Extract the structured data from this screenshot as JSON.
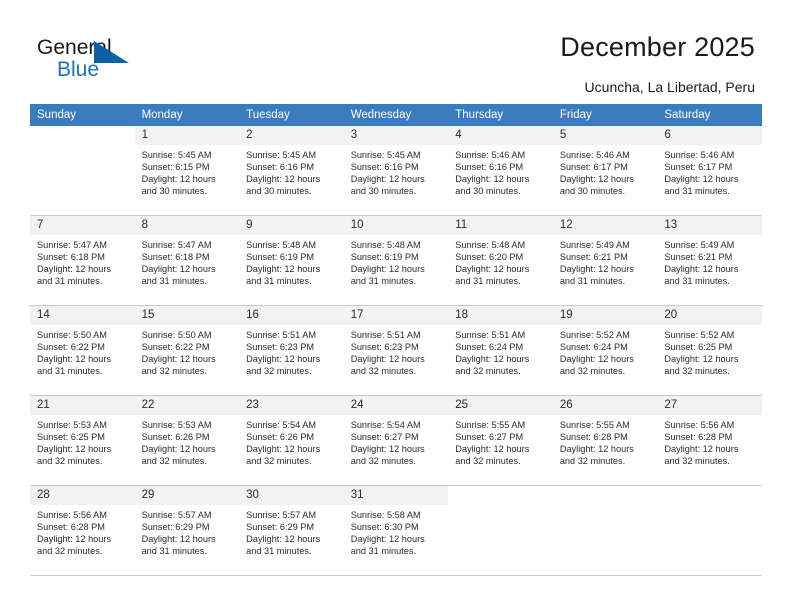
{
  "brand": {
    "name_part1": "General",
    "name_part2": "Blue"
  },
  "header": {
    "title": "December 2025",
    "location": "Ucuncha, La Libertad, Peru"
  },
  "colors": {
    "header_row_bg": "#3a7cbe",
    "daynum_bg": "#f2f2f2",
    "brand_blue": "#1d71b8",
    "text": "#2b2b2b"
  },
  "weekday_headers": [
    "Sunday",
    "Monday",
    "Tuesday",
    "Wednesday",
    "Thursday",
    "Friday",
    "Saturday"
  ],
  "labels": {
    "sunrise": "Sunrise:",
    "sunset": "Sunset:",
    "daylight": "Daylight:"
  },
  "weeks": [
    [
      {
        "day": "",
        "sunrise": "",
        "sunset": "",
        "daylight_l1": "",
        "daylight_l2": ""
      },
      {
        "day": "1",
        "sunrise": "Sunrise: 5:45 AM",
        "sunset": "Sunset: 6:15 PM",
        "daylight_l1": "Daylight: 12 hours",
        "daylight_l2": "and 30 minutes."
      },
      {
        "day": "2",
        "sunrise": "Sunrise: 5:45 AM",
        "sunset": "Sunset: 6:16 PM",
        "daylight_l1": "Daylight: 12 hours",
        "daylight_l2": "and 30 minutes."
      },
      {
        "day": "3",
        "sunrise": "Sunrise: 5:45 AM",
        "sunset": "Sunset: 6:16 PM",
        "daylight_l1": "Daylight: 12 hours",
        "daylight_l2": "and 30 minutes."
      },
      {
        "day": "4",
        "sunrise": "Sunrise: 5:46 AM",
        "sunset": "Sunset: 6:16 PM",
        "daylight_l1": "Daylight: 12 hours",
        "daylight_l2": "and 30 minutes."
      },
      {
        "day": "5",
        "sunrise": "Sunrise: 5:46 AM",
        "sunset": "Sunset: 6:17 PM",
        "daylight_l1": "Daylight: 12 hours",
        "daylight_l2": "and 30 minutes."
      },
      {
        "day": "6",
        "sunrise": "Sunrise: 5:46 AM",
        "sunset": "Sunset: 6:17 PM",
        "daylight_l1": "Daylight: 12 hours",
        "daylight_l2": "and 31 minutes."
      }
    ],
    [
      {
        "day": "7",
        "sunrise": "Sunrise: 5:47 AM",
        "sunset": "Sunset: 6:18 PM",
        "daylight_l1": "Daylight: 12 hours",
        "daylight_l2": "and 31 minutes."
      },
      {
        "day": "8",
        "sunrise": "Sunrise: 5:47 AM",
        "sunset": "Sunset: 6:18 PM",
        "daylight_l1": "Daylight: 12 hours",
        "daylight_l2": "and 31 minutes."
      },
      {
        "day": "9",
        "sunrise": "Sunrise: 5:48 AM",
        "sunset": "Sunset: 6:19 PM",
        "daylight_l1": "Daylight: 12 hours",
        "daylight_l2": "and 31 minutes."
      },
      {
        "day": "10",
        "sunrise": "Sunrise: 5:48 AM",
        "sunset": "Sunset: 6:19 PM",
        "daylight_l1": "Daylight: 12 hours",
        "daylight_l2": "and 31 minutes."
      },
      {
        "day": "11",
        "sunrise": "Sunrise: 5:48 AM",
        "sunset": "Sunset: 6:20 PM",
        "daylight_l1": "Daylight: 12 hours",
        "daylight_l2": "and 31 minutes."
      },
      {
        "day": "12",
        "sunrise": "Sunrise: 5:49 AM",
        "sunset": "Sunset: 6:21 PM",
        "daylight_l1": "Daylight: 12 hours",
        "daylight_l2": "and 31 minutes."
      },
      {
        "day": "13",
        "sunrise": "Sunrise: 5:49 AM",
        "sunset": "Sunset: 6:21 PM",
        "daylight_l1": "Daylight: 12 hours",
        "daylight_l2": "and 31 minutes."
      }
    ],
    [
      {
        "day": "14",
        "sunrise": "Sunrise: 5:50 AM",
        "sunset": "Sunset: 6:22 PM",
        "daylight_l1": "Daylight: 12 hours",
        "daylight_l2": "and 31 minutes."
      },
      {
        "day": "15",
        "sunrise": "Sunrise: 5:50 AM",
        "sunset": "Sunset: 6:22 PM",
        "daylight_l1": "Daylight: 12 hours",
        "daylight_l2": "and 32 minutes."
      },
      {
        "day": "16",
        "sunrise": "Sunrise: 5:51 AM",
        "sunset": "Sunset: 6:23 PM",
        "daylight_l1": "Daylight: 12 hours",
        "daylight_l2": "and 32 minutes."
      },
      {
        "day": "17",
        "sunrise": "Sunrise: 5:51 AM",
        "sunset": "Sunset: 6:23 PM",
        "daylight_l1": "Daylight: 12 hours",
        "daylight_l2": "and 32 minutes."
      },
      {
        "day": "18",
        "sunrise": "Sunrise: 5:51 AM",
        "sunset": "Sunset: 6:24 PM",
        "daylight_l1": "Daylight: 12 hours",
        "daylight_l2": "and 32 minutes."
      },
      {
        "day": "19",
        "sunrise": "Sunrise: 5:52 AM",
        "sunset": "Sunset: 6:24 PM",
        "daylight_l1": "Daylight: 12 hours",
        "daylight_l2": "and 32 minutes."
      },
      {
        "day": "20",
        "sunrise": "Sunrise: 5:52 AM",
        "sunset": "Sunset: 6:25 PM",
        "daylight_l1": "Daylight: 12 hours",
        "daylight_l2": "and 32 minutes."
      }
    ],
    [
      {
        "day": "21",
        "sunrise": "Sunrise: 5:53 AM",
        "sunset": "Sunset: 6:25 PM",
        "daylight_l1": "Daylight: 12 hours",
        "daylight_l2": "and 32 minutes."
      },
      {
        "day": "22",
        "sunrise": "Sunrise: 5:53 AM",
        "sunset": "Sunset: 6:26 PM",
        "daylight_l1": "Daylight: 12 hours",
        "daylight_l2": "and 32 minutes."
      },
      {
        "day": "23",
        "sunrise": "Sunrise: 5:54 AM",
        "sunset": "Sunset: 6:26 PM",
        "daylight_l1": "Daylight: 12 hours",
        "daylight_l2": "and 32 minutes."
      },
      {
        "day": "24",
        "sunrise": "Sunrise: 5:54 AM",
        "sunset": "Sunset: 6:27 PM",
        "daylight_l1": "Daylight: 12 hours",
        "daylight_l2": "and 32 minutes."
      },
      {
        "day": "25",
        "sunrise": "Sunrise: 5:55 AM",
        "sunset": "Sunset: 6:27 PM",
        "daylight_l1": "Daylight: 12 hours",
        "daylight_l2": "and 32 minutes."
      },
      {
        "day": "26",
        "sunrise": "Sunrise: 5:55 AM",
        "sunset": "Sunset: 6:28 PM",
        "daylight_l1": "Daylight: 12 hours",
        "daylight_l2": "and 32 minutes."
      },
      {
        "day": "27",
        "sunrise": "Sunrise: 5:56 AM",
        "sunset": "Sunset: 6:28 PM",
        "daylight_l1": "Daylight: 12 hours",
        "daylight_l2": "and 32 minutes."
      }
    ],
    [
      {
        "day": "28",
        "sunrise": "Sunrise: 5:56 AM",
        "sunset": "Sunset: 6:28 PM",
        "daylight_l1": "Daylight: 12 hours",
        "daylight_l2": "and 32 minutes."
      },
      {
        "day": "29",
        "sunrise": "Sunrise: 5:57 AM",
        "sunset": "Sunset: 6:29 PM",
        "daylight_l1": "Daylight: 12 hours",
        "daylight_l2": "and 31 minutes."
      },
      {
        "day": "30",
        "sunrise": "Sunrise: 5:57 AM",
        "sunset": "Sunset: 6:29 PM",
        "daylight_l1": "Daylight: 12 hours",
        "daylight_l2": "and 31 minutes."
      },
      {
        "day": "31",
        "sunrise": "Sunrise: 5:58 AM",
        "sunset": "Sunset: 6:30 PM",
        "daylight_l1": "Daylight: 12 hours",
        "daylight_l2": "and 31 minutes."
      },
      {
        "day": "",
        "sunrise": "",
        "sunset": "",
        "daylight_l1": "",
        "daylight_l2": ""
      },
      {
        "day": "",
        "sunrise": "",
        "sunset": "",
        "daylight_l1": "",
        "daylight_l2": ""
      },
      {
        "day": "",
        "sunrise": "",
        "sunset": "",
        "daylight_l1": "",
        "daylight_l2": ""
      }
    ]
  ]
}
